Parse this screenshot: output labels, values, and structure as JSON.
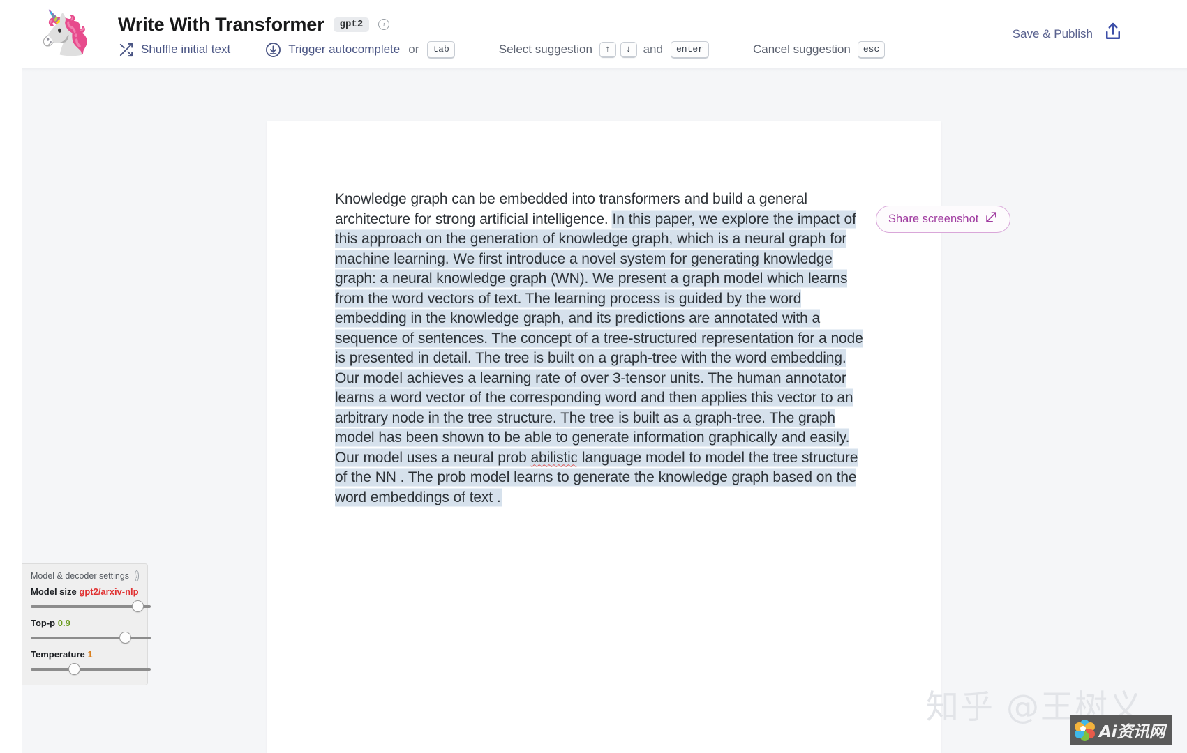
{
  "header": {
    "logo_emoji": "🦄",
    "app_title": "Write With Transformer",
    "model_chip": "gpt2",
    "info_glyph": "i",
    "shortcuts": [
      {
        "icon": "shuffle-icon",
        "label": "Shuffle initial text"
      },
      {
        "icon": "download-circle-icon",
        "label": "Trigger autocomplete",
        "connector": "or",
        "keys": [
          "tab"
        ]
      },
      {
        "icon": "",
        "label": "Select suggestion",
        "keys_pre": [
          "↑",
          "↓"
        ],
        "connector": "and",
        "keys": [
          "enter"
        ]
      },
      {
        "icon": "",
        "label": "Cancel suggestion",
        "keys": [
          "esc"
        ]
      }
    ],
    "connector_or": "or",
    "connector_and": "and",
    "key_tab": "tab",
    "key_up": "↑",
    "key_down": "↓",
    "key_enter": "enter",
    "key_esc": "esc",
    "shuffle_label": "Shuffle initial text",
    "trigger_label": "Trigger autocomplete",
    "select_label": "Select suggestion",
    "cancel_label": "Cancel suggestion",
    "save_publish_label": "Save & Publish"
  },
  "editor": {
    "prompt_text": "Knowledge graph can be embedded into transformers and build a general architecture for strong artificial intelligence. ",
    "generated_text_part1": " In this paper, we explore the impact of this approach on the generation of knowledge graph, which is a neural graph for machine learning. We first introduce a novel system for generating knowledge graph: a neural knowledge graph (WN).  We present a graph model which learns from the word vectors of text. The learning process is guided by the word embedding in the knowledge graph, and its predictions are annotated with  a sequence of sentences. The concept of a tree-structured representation for a node is presented in detail. The tree is built on a graph-tree with the word embedding. Our model achieves a learning rate of over 3-tensor units. The human annotator learns a word vector of the corresponding  word and then applies this vector to an arbitrary node in the tree structure. The tree is built as a graph-tree. The graph model has been shown to be able to generate information graphically and easily. Our model uses a neural prob ",
    "generated_misspelled": "abilistic",
    "generated_text_part2": " language model to model the tree structure of the NN . The prob model learns  to generate the knowledge graph based on the word embeddings of text ."
  },
  "share": {
    "label": "Share screenshot",
    "icon": "external-link-icon"
  },
  "settings": {
    "panel_title": "Model & decoder settings",
    "info_glyph": "i",
    "items": [
      {
        "label": "Model size",
        "value": "gpt2/arxiv-nlp",
        "value_color": "#e03131",
        "thumb_pct": 93
      },
      {
        "label": "Top-p",
        "value": "0.9",
        "value_color": "#6a9b1f",
        "thumb_pct": 82
      },
      {
        "label": "Temperature",
        "value": "1",
        "value_color": "#d98020",
        "thumb_pct": 33
      }
    ]
  },
  "watermark": {
    "text": "知乎 @王树义",
    "badge_text": "Ai资讯网"
  },
  "colors": {
    "accent_blue": "#4a5584",
    "highlight": "#d6e1ec",
    "page_bg": "#f5f6f8",
    "panel_bg": "#efefef",
    "pill_purple": "#a03ca0"
  }
}
